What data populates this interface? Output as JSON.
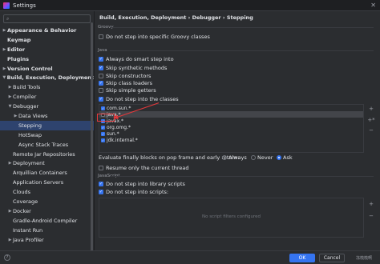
{
  "window": {
    "title": "Settings"
  },
  "sidebar": {
    "search_placeholder": "",
    "items": [
      {
        "label": "Appearance & Behavior",
        "level": 0,
        "arrow": "collapsed",
        "bold": true
      },
      {
        "label": "Keymap",
        "level": 0,
        "arrow": "none",
        "bold": true
      },
      {
        "label": "Editor",
        "level": 0,
        "arrow": "collapsed",
        "bold": true
      },
      {
        "label": "Plugins",
        "level": 0,
        "arrow": "none",
        "bold": true
      },
      {
        "label": "Version Control",
        "level": 0,
        "arrow": "collapsed",
        "bold": true
      },
      {
        "label": "Build, Execution, Deployment",
        "level": 0,
        "arrow": "expanded",
        "bold": true
      },
      {
        "label": "Build Tools",
        "level": 1,
        "arrow": "collapsed"
      },
      {
        "label": "Compiler",
        "level": 1,
        "arrow": "collapsed"
      },
      {
        "label": "Debugger",
        "level": 1,
        "arrow": "expanded"
      },
      {
        "label": "Data Views",
        "level": 2,
        "arrow": "collapsed"
      },
      {
        "label": "Stepping",
        "level": 2,
        "arrow": "none",
        "selected": true
      },
      {
        "label": "HotSwap",
        "level": 2,
        "arrow": "none"
      },
      {
        "label": "Async Stack Traces",
        "level": 2,
        "arrow": "none"
      },
      {
        "label": "Remote Jar Repositories",
        "level": 1,
        "arrow": "none"
      },
      {
        "label": "Deployment",
        "level": 1,
        "arrow": "collapsed"
      },
      {
        "label": "Arquillian Containers",
        "level": 1,
        "arrow": "none"
      },
      {
        "label": "Application Servers",
        "level": 1,
        "arrow": "none"
      },
      {
        "label": "Clouds",
        "level": 1,
        "arrow": "none"
      },
      {
        "label": "Coverage",
        "level": 1,
        "arrow": "none"
      },
      {
        "label": "Docker",
        "level": 1,
        "arrow": "collapsed"
      },
      {
        "label": "Gradle-Android Compiler",
        "level": 1,
        "arrow": "none"
      },
      {
        "label": "Instant Run",
        "level": 1,
        "arrow": "none"
      },
      {
        "label": "Java Profiler",
        "level": 1,
        "arrow": "collapsed"
      }
    ]
  },
  "breadcrumb": "Build, Execution, Deployment  ›  Debugger  ›  Stepping",
  "groovy": {
    "label": "Groovy",
    "do_not_step_specific": {
      "label": "Do not step into specific Groovy classes",
      "checked": false
    }
  },
  "java": {
    "label": "Java",
    "options": [
      {
        "label": "Always do smart step into",
        "checked": true
      },
      {
        "label": "Skip synthetic methods",
        "checked": true
      },
      {
        "label": "Skip constructors",
        "checked": false
      },
      {
        "label": "Skip class loaders",
        "checked": true
      },
      {
        "label": "Skip simple getters",
        "checked": false
      },
      {
        "label": "Do not step into the classes",
        "checked": true
      }
    ],
    "filters": [
      {
        "label": "com.sun.*",
        "checked": true
      },
      {
        "label": "java.*",
        "checked": false,
        "selected": true
      },
      {
        "label": "javax.*",
        "checked": true
      },
      {
        "label": "org.omg.*",
        "checked": true
      },
      {
        "label": "sun.*",
        "checked": true
      },
      {
        "label": "jdk.internal.*",
        "checked": true
      }
    ],
    "evaluate_label": "Evaluate finally blocks on pop frame and early return:",
    "evaluate_options": [
      {
        "label": "Always",
        "selected": false
      },
      {
        "label": "Never",
        "selected": false
      },
      {
        "label": "Ask",
        "selected": true
      }
    ],
    "resume_only_current": {
      "label": "Resume only the current thread",
      "checked": false
    }
  },
  "javascript": {
    "label": "JavaScript",
    "do_not_step_library": {
      "label": "Do not step into library scripts",
      "checked": true
    },
    "do_not_step_scripts": {
      "label": "Do not step into scripts:",
      "checked": true
    },
    "empty_text": "No script filters configured"
  },
  "footer": {
    "ok_label": "OK",
    "cancel_label": "Cancel",
    "help_label": "?",
    "watermark": "冻梳梳啊"
  },
  "icons": {
    "add": "+",
    "remove": "−",
    "add_pattern": "+*"
  },
  "colors": {
    "accent": "#3574f0",
    "selection": "#2e436e",
    "highlight": "#e5383b"
  }
}
